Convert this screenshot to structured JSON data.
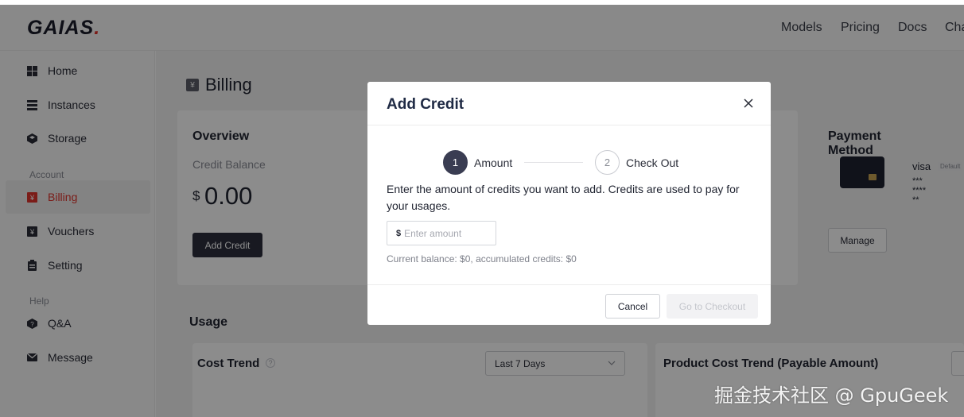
{
  "app": {
    "logo_text": "GAIAS",
    "logo_dot": ".",
    "brand_color": "#e0342c"
  },
  "topnav": {
    "models": "Models",
    "pricing": "Pricing",
    "docs": "Docs",
    "chat": "Cha"
  },
  "sidebar": {
    "home": "Home",
    "instances": "Instances",
    "storage": "Storage",
    "section_account": "Account",
    "billing": "Billing",
    "vouchers": "Vouchers",
    "setting": "Setting",
    "section_help": "Help",
    "qa": "Q&A",
    "message": "Message"
  },
  "page": {
    "title": "Billing",
    "title_icon": "¥"
  },
  "overview": {
    "title": "Overview",
    "credit_label": "Credit Balance",
    "currency": "$",
    "amount": "0.00",
    "add_credit": "Add Credit"
  },
  "payment": {
    "title": "Payment Method",
    "brand": "visa",
    "badge": "Default",
    "masked": "*** **** **",
    "manage": "Manage"
  },
  "usage": {
    "title": "Usage",
    "cost_trend": "Cost Trend",
    "range": "Last 7 Days",
    "product_trend": "Product Cost Trend (Payable Amount)"
  },
  "modal": {
    "title": "Add Credit",
    "step1_num": "1",
    "step1_label": "Amount",
    "step2_num": "2",
    "step2_label": "Check Out",
    "description": "Enter the amount of credits you want to add. Credits are used to pay for your usages.",
    "currency": "$",
    "amount_placeholder": "Enter amount",
    "amount_value": "",
    "balance_line": "Current balance: $0, accumulated credits: $0",
    "cancel": "Cancel",
    "checkout": "Go to Checkout"
  },
  "watermark": "掘金技术社区 @ GpuGeek"
}
